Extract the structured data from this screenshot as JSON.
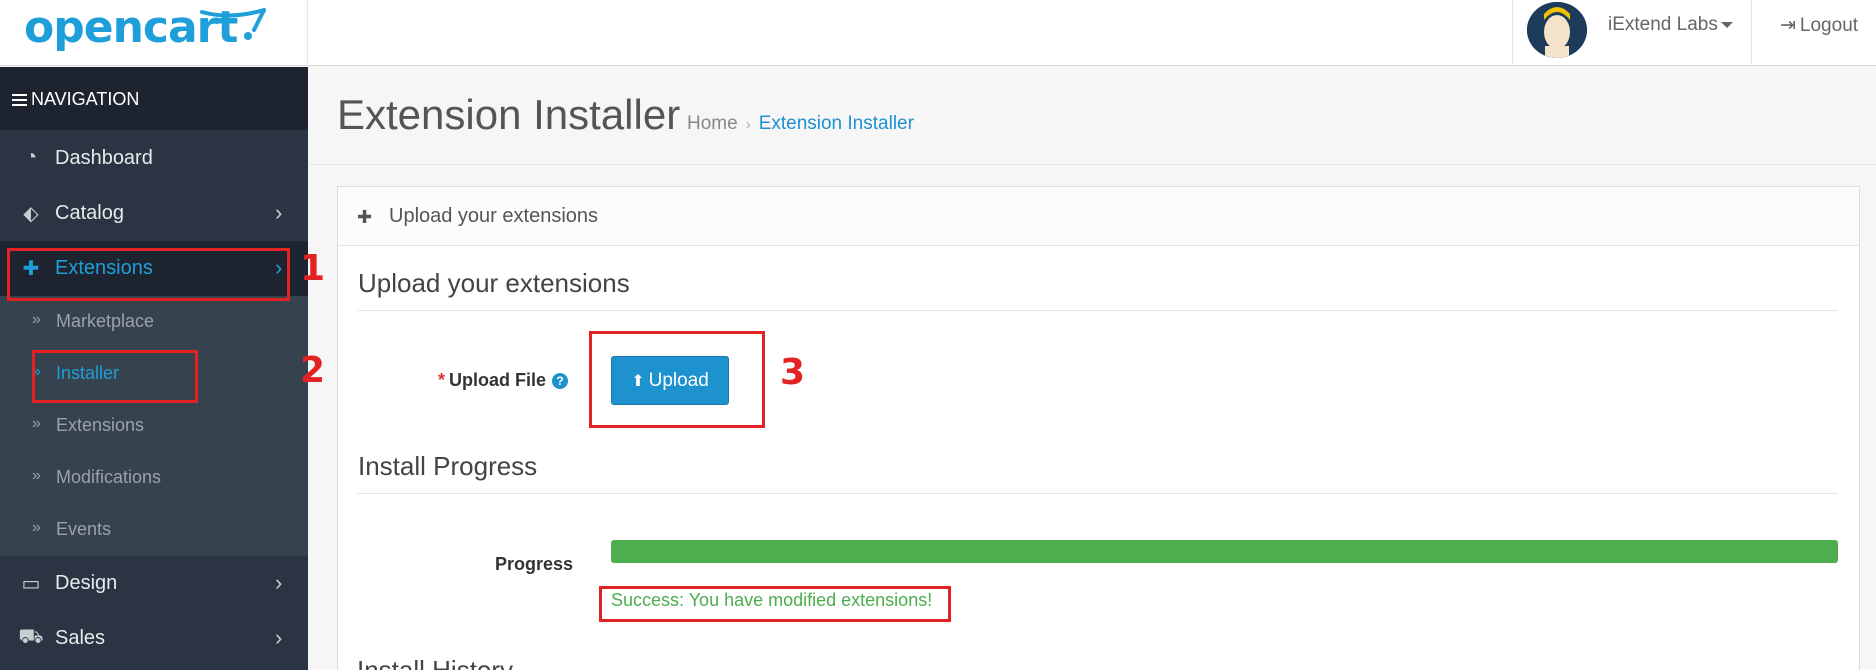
{
  "header": {
    "logo_text": "opencart",
    "user_name": "iExtend Labs",
    "logout_label": "Logout"
  },
  "sidebar": {
    "nav_title": "NAVIGATION",
    "items": [
      {
        "label": "Dashboard",
        "icon": "dashboard-icon"
      },
      {
        "label": "Catalog",
        "icon": "tags-icon"
      },
      {
        "label": "Extensions",
        "icon": "puzzle-icon"
      },
      {
        "label": "Design",
        "icon": "monitor-icon"
      },
      {
        "label": "Sales",
        "icon": "cart-icon"
      }
    ],
    "extensions_sub": [
      {
        "label": "Marketplace"
      },
      {
        "label": "Installer"
      },
      {
        "label": "Extensions"
      },
      {
        "label": "Modifications"
      },
      {
        "label": "Events"
      }
    ]
  },
  "page": {
    "title": "Extension Installer",
    "breadcrumb": [
      "Home",
      "Extension Installer"
    ]
  },
  "panel": {
    "heading": "Upload your extensions",
    "upload_section_title": "Upload your extensions",
    "upload_file_label": "Upload File",
    "upload_button_label": "Upload",
    "progress_section_title": "Install Progress",
    "progress_label": "Progress",
    "progress_value": 1.0,
    "success_message": "Success: You have modified extensions!",
    "next_section_title": "Install History"
  },
  "annotations": [
    "1",
    "2",
    "3"
  ],
  "colors": {
    "brand": "#1e9fd9",
    "sidebar_bg": "#2a3442",
    "success": "#4cae4c",
    "annotation": "#e32323"
  }
}
